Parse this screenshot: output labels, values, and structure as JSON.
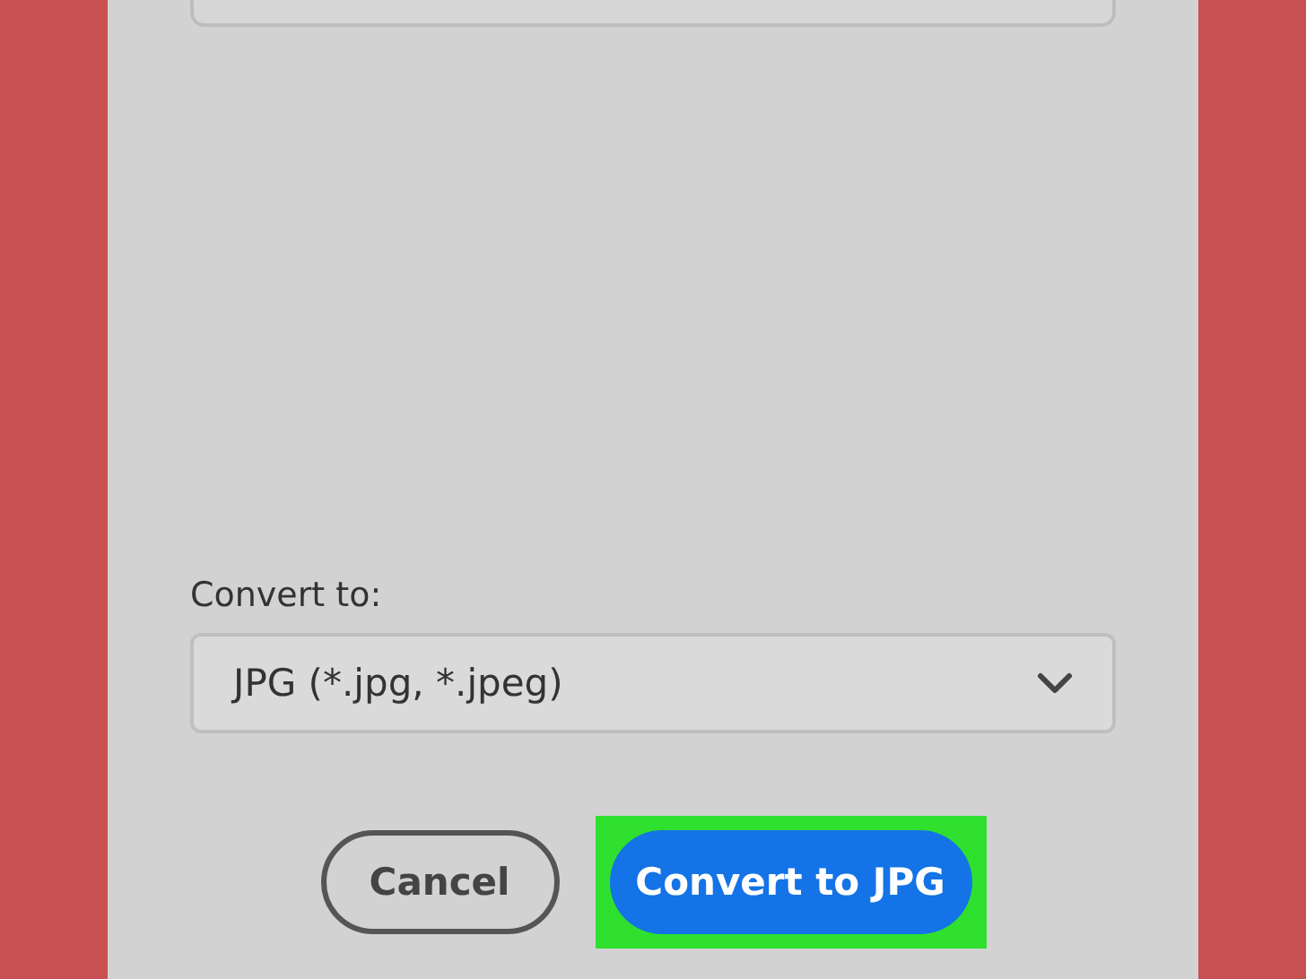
{
  "convert_to": {
    "label": "Convert to:",
    "dropdown": {
      "value": "JPG (*.jpg, *.jpeg)"
    }
  },
  "buttons": [
    {
      "label": "Cancel",
      "kind": "secondary",
      "highlighted": false
    },
    {
      "label": "Convert to JPG",
      "kind": "primary",
      "highlighted": true
    }
  ]
}
